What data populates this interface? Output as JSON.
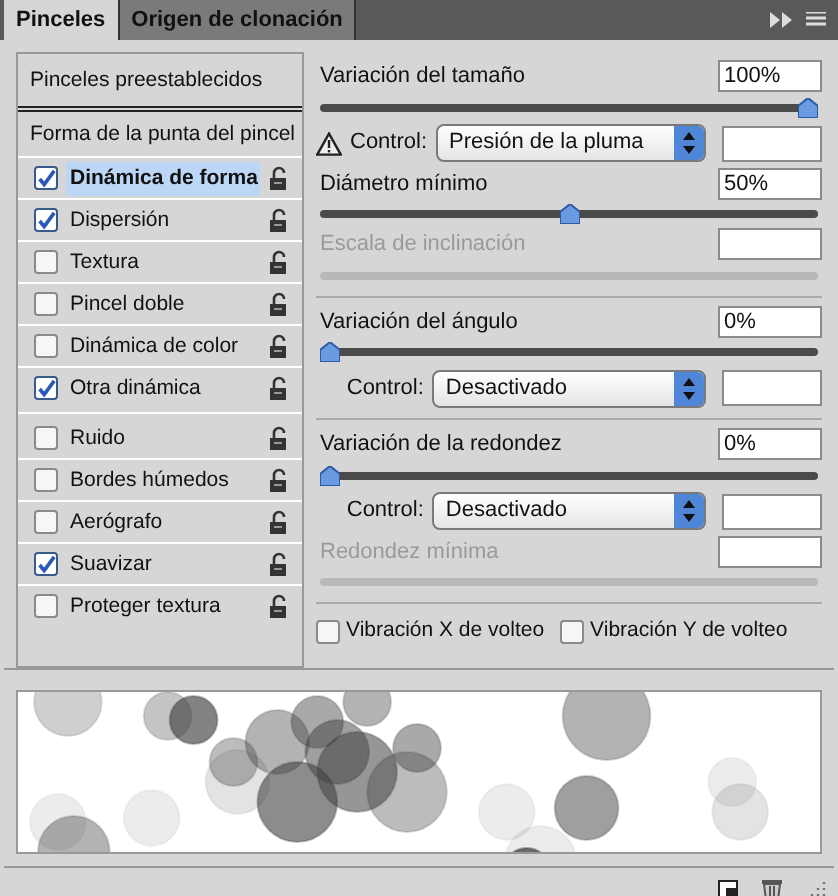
{
  "tabs": [
    {
      "label": "Pinceles",
      "selected": true
    },
    {
      "label": "Origen de clonación",
      "selected": false
    }
  ],
  "brush_list": {
    "groups": [
      {
        "items": [
          {
            "kind": "link",
            "label": "Pinceles preestablecidos",
            "selected": false
          }
        ]
      },
      {
        "items": [
          {
            "kind": "link",
            "label": "Forma de la punta del pincel",
            "selected": false
          },
          {
            "kind": "option",
            "label": "Dinámica de forma",
            "checked": true,
            "selected": true
          },
          {
            "kind": "option",
            "label": "Dispersión",
            "checked": true,
            "selected": false
          },
          {
            "kind": "option",
            "label": "Textura",
            "checked": false,
            "selected": false
          },
          {
            "kind": "option",
            "label": "Pincel doble",
            "checked": false,
            "selected": false
          },
          {
            "kind": "option",
            "label": "Dinámica de color",
            "checked": false,
            "selected": false
          },
          {
            "kind": "option",
            "label": "Otra dinámica",
            "checked": true,
            "selected": false
          }
        ]
      },
      {
        "items": [
          {
            "kind": "option",
            "label": "Ruido",
            "checked": false,
            "selected": false
          },
          {
            "kind": "option",
            "label": "Bordes húmedos",
            "checked": false,
            "selected": false
          },
          {
            "kind": "option",
            "label": "Aerógrafo",
            "checked": false,
            "selected": false
          },
          {
            "kind": "option",
            "label": "Suavizar",
            "checked": true,
            "selected": false
          },
          {
            "kind": "option",
            "label": "Proteger textura",
            "checked": false,
            "selected": false
          }
        ]
      }
    ]
  },
  "settings": {
    "sections": [
      {
        "rows": [
          {
            "kind": "slider",
            "label": "Variación del tamaño",
            "value": "100%",
            "level": 1,
            "disabled": false
          },
          {
            "kind": "control",
            "label": "Control:",
            "value": "Presión de la pluma",
            "warning": true
          },
          {
            "kind": "slider",
            "label": "Diámetro mínimo",
            "value": "50%",
            "level": 0.5,
            "disabled": false
          },
          {
            "kind": "slider",
            "label": "Escala de inclinación",
            "disabled": true
          }
        ]
      },
      {
        "rows": [
          {
            "kind": "slider",
            "label": "Variación del ángulo",
            "value": "0%",
            "level": 0,
            "disabled": false
          },
          {
            "kind": "control",
            "label": "Control:",
            "value": "Desactivado",
            "warning": false
          }
        ]
      },
      {
        "rows": [
          {
            "kind": "slider",
            "label": "Variación de la redondez",
            "value": "0%",
            "level": 0,
            "disabled": false
          },
          {
            "kind": "control",
            "label": "Control:",
            "value": "Desactivado",
            "warning": false
          },
          {
            "kind": "slider",
            "label": "Redondez mínima",
            "disabled": true
          }
        ]
      }
    ],
    "flips": [
      {
        "label": "Vibración X de volteo",
        "checked": false
      },
      {
        "label": "Vibración Y de volteo",
        "checked": false
      }
    ]
  }
}
